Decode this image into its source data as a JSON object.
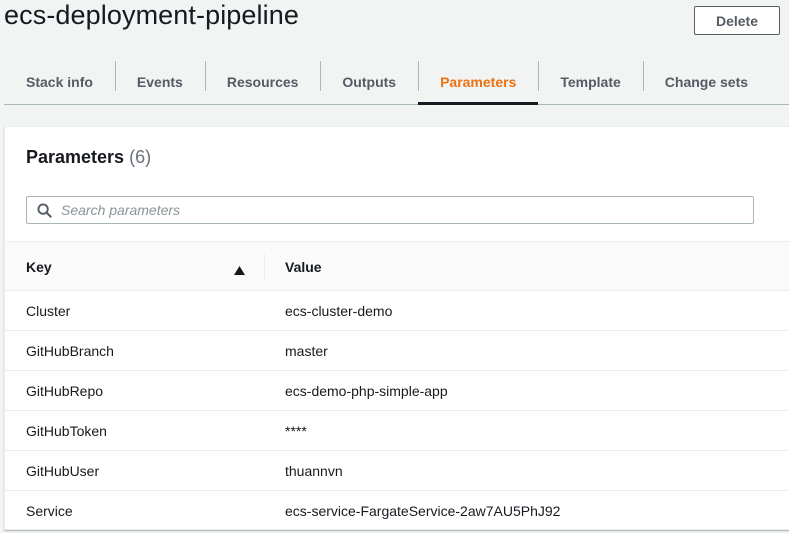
{
  "header": {
    "title": "ecs-deployment-pipeline",
    "delete_label": "Delete"
  },
  "tabs": [
    {
      "label": "Stack info",
      "active": false
    },
    {
      "label": "Events",
      "active": false
    },
    {
      "label": "Resources",
      "active": false
    },
    {
      "label": "Outputs",
      "active": false
    },
    {
      "label": "Parameters",
      "active": true
    },
    {
      "label": "Template",
      "active": false
    },
    {
      "label": "Change sets",
      "active": false
    }
  ],
  "panel": {
    "title": "Parameters",
    "count": "(6)"
  },
  "search": {
    "placeholder": "Search parameters",
    "value": ""
  },
  "table": {
    "columns": {
      "key": "Key",
      "value": "Value"
    },
    "sort": {
      "column": "Key",
      "direction": "ascending"
    },
    "rows": [
      {
        "key": "Cluster",
        "value": "ecs-cluster-demo"
      },
      {
        "key": "GitHubBranch",
        "value": "master"
      },
      {
        "key": "GitHubRepo",
        "value": "ecs-demo-php-simple-app"
      },
      {
        "key": "GitHubToken",
        "value": "****"
      },
      {
        "key": "GitHubUser",
        "value": "thuannvn"
      },
      {
        "key": "Service",
        "value": "ecs-service-FargateService-2aw7AU5PhJ92"
      }
    ]
  },
  "icons": {
    "search": "search-icon",
    "sort": "sort-ascending-icon"
  },
  "colors": {
    "accent": "#ec7211",
    "text": "#16191f",
    "muted": "#545b64",
    "background": "#f2f3f3"
  }
}
